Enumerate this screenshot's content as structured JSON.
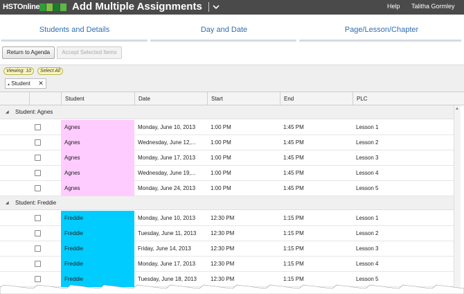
{
  "app": {
    "logo_text": "HSTOnline",
    "title": "Add Multiple Assignments",
    "help": "Help",
    "user": "Talitha Gormley"
  },
  "steps": [
    "Students and Details",
    "Day and Date",
    "Page/Lesson/Chapter"
  ],
  "buttons": {
    "return": "Return to Agenda",
    "accept": "Accept Selected Items"
  },
  "viewbar": {
    "viewing": "Viewing: 10",
    "select_all": "Select All",
    "group_chip": "Student"
  },
  "columns": [
    "Student",
    "Date",
    "Start",
    "End",
    "PLC"
  ],
  "groups": [
    {
      "label": "Student: Agnes",
      "color": "#ffccff",
      "rows": [
        {
          "student": "Agnes",
          "date": "Monday, June 10, 2013",
          "start": "1:00 PM",
          "end": "1:45 PM",
          "plc": "Lesson 1"
        },
        {
          "student": "Agnes",
          "date": "Wednesday, June 12,...",
          "start": "1:00 PM",
          "end": "1:45 PM",
          "plc": "Lesson 2"
        },
        {
          "student": "Agnes",
          "date": "Monday, June 17, 2013",
          "start": "1:00 PM",
          "end": "1:45 PM",
          "plc": "Lesson 3"
        },
        {
          "student": "Agnes",
          "date": "Wednesday, June 19,...",
          "start": "1:00 PM",
          "end": "1:45 PM",
          "plc": "Lesson 4"
        },
        {
          "student": "Agnes",
          "date": "Monday, June 24, 2013",
          "start": "1:00 PM",
          "end": "1:45 PM",
          "plc": "Lesson 5"
        }
      ]
    },
    {
      "label": "Student: Freddie",
      "color": "#00ccff",
      "rows": [
        {
          "student": "Freddie",
          "date": "Monday, June 10, 2013",
          "start": "12:30 PM",
          "end": "1:15 PM",
          "plc": "Lesson 1"
        },
        {
          "student": "Freddie",
          "date": "Tuesday, June 11, 2013",
          "start": "12:30 PM",
          "end": "1:15 PM",
          "plc": "Lesson 2"
        },
        {
          "student": "Freddie",
          "date": "Friday, June 14, 2013",
          "start": "12:30 PM",
          "end": "1:15 PM",
          "plc": "Lesson 3"
        },
        {
          "student": "Freddie",
          "date": "Monday, June 17, 2013",
          "start": "12:30 PM",
          "end": "1:15 PM",
          "plc": "Lesson 4"
        },
        {
          "student": "Freddie",
          "date": "Tuesday, June 18, 2013",
          "start": "12:30 PM",
          "end": "1:15 PM",
          "plc": "Lesson 5"
        }
      ]
    }
  ]
}
